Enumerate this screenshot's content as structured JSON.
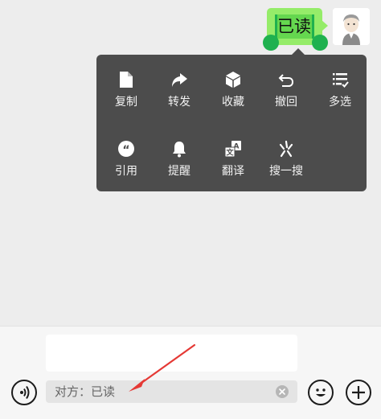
{
  "message": {
    "text": "已读"
  },
  "context_menu": {
    "row1": [
      {
        "label": "复制",
        "icon": "copy-icon"
      },
      {
        "label": "转发",
        "icon": "forward-icon"
      },
      {
        "label": "收藏",
        "icon": "favorite-icon"
      },
      {
        "label": "撤回",
        "icon": "recall-icon"
      },
      {
        "label": "多选",
        "icon": "multiselect-icon"
      }
    ],
    "row2": [
      {
        "label": "引用",
        "icon": "quote-icon"
      },
      {
        "label": "提醒",
        "icon": "bell-icon"
      },
      {
        "label": "翻译",
        "icon": "translate-icon"
      },
      {
        "label": "搜一搜",
        "icon": "search-sparkle-icon"
      }
    ]
  },
  "input_bar": {
    "quote_text": "对方：已读",
    "icons": [
      "voice-icon",
      "clear-icon",
      "emoji-icon",
      "plus-icon"
    ]
  },
  "colors": {
    "bubble": "#95ec69",
    "selection_handle": "#1fb14f",
    "menu_bg": "#4c4c4c",
    "annotation_arrow": "#e53935"
  }
}
